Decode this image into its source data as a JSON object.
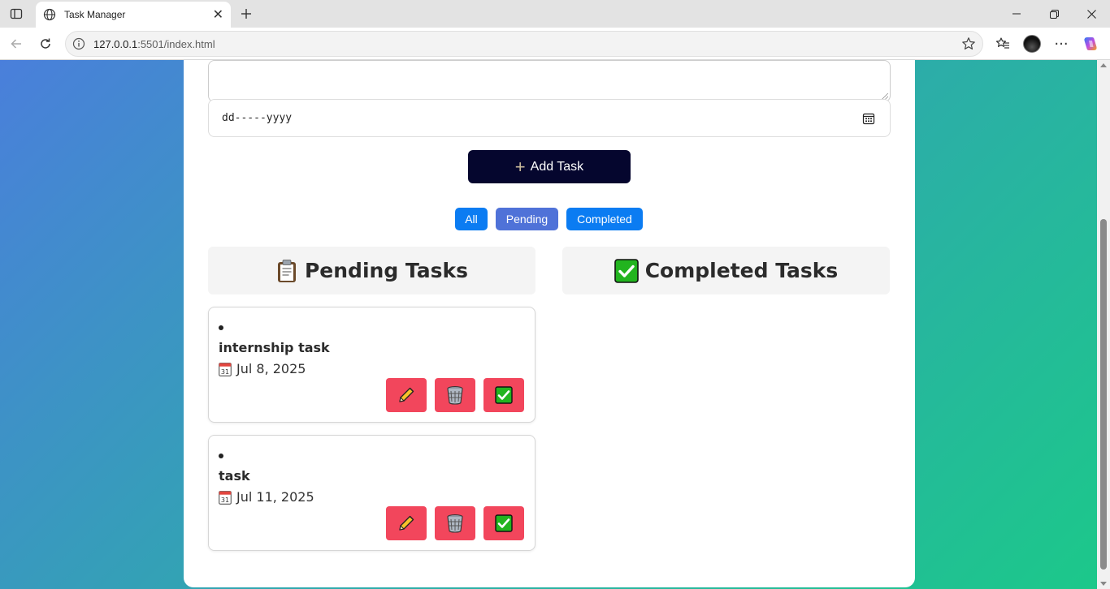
{
  "browser": {
    "tab_title": "Task Manager",
    "url_host": "127.0.0.1",
    "url_path": ":5501/index.html",
    "more_label": "···"
  },
  "form": {
    "date_value": "dd-----yyyy",
    "add_button_label": "Add Task"
  },
  "filters": {
    "all": "All",
    "pending": "Pending",
    "completed": "Completed",
    "active": "pending"
  },
  "columns": {
    "pending_title": "Pending Tasks",
    "completed_title": "Completed Tasks"
  },
  "pending_tasks": [
    {
      "name": "internship task",
      "date": "Jul 8, 2025"
    },
    {
      "name": "task",
      "date": "Jul 11, 2025"
    }
  ],
  "icons": {
    "tab_favicon": "globe-icon",
    "edit": "pencil-icon",
    "delete": "wastebasket-icon",
    "complete": "check-mark-button-icon",
    "pending_header": "clipboard-icon",
    "completed_header": "check-mark-button-icon",
    "task_date": "calendar-icon"
  },
  "colors": {
    "add_button_bg": "#05062e",
    "filter_bg": "#0b7cf2",
    "filter_active_bg": "#4f72d8",
    "action_button_bg": "#f2465c",
    "gradient_start": "#4a7fdb",
    "gradient_end": "#1cc88a"
  }
}
